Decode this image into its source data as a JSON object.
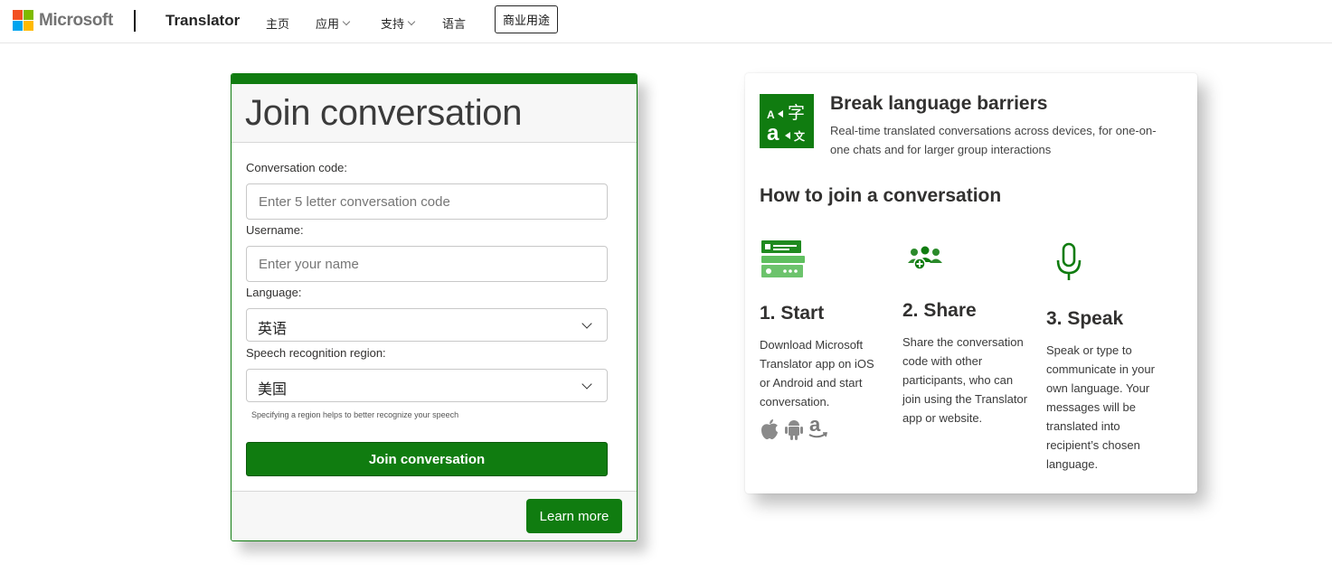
{
  "nav": {
    "logo_text": "Microsoft",
    "logo_colors": [
      "#f25022",
      "#7fba00",
      "#00a4ef",
      "#ffb900"
    ],
    "brand": "Translator",
    "links": [
      {
        "label": "主页",
        "has_menu": false
      },
      {
        "label": "应用",
        "has_menu": true
      },
      {
        "label": "支持",
        "has_menu": true
      },
      {
        "label": "语言",
        "has_menu": false
      }
    ],
    "business_button": "商业用途"
  },
  "join": {
    "title": "Join conversation",
    "code_label": "Conversation code:",
    "code_placeholder": "Enter 5 letter conversation code",
    "username_label": "Username:",
    "username_placeholder": "Enter your name",
    "language_label": "Language:",
    "language_value": "英语",
    "region_label": "Speech recognition region:",
    "region_value": "美国",
    "region_hint": "Specifying a region helps to better recognize your speech",
    "join_button": "Join conversation",
    "learn_more": "Learn more"
  },
  "info": {
    "title": "Break language barriers",
    "subtitle": "Real-time translated conversations across devices, for one-on-one chats and for larger group interactions",
    "howto": "How to join a conversation",
    "steps": [
      {
        "title": "1. Start",
        "text": "Download Microsoft Translator app on iOS or Android and start conversation.",
        "icon": "start-screen-icon"
      },
      {
        "title": "2. Share",
        "text": "Share the conversation code with other participants, who can join using the Translator app or website.",
        "icon": "people-share-icon"
      },
      {
        "title": "3. Speak",
        "text": "Speak or type to communicate in your own language. Your messages will be translated into recipient’s chosen language.",
        "icon": "microphone-icon"
      }
    ],
    "platform_icons": [
      "apple-icon",
      "android-icon",
      "amazon-icon"
    ]
  },
  "colors": {
    "accent": "#107c10"
  }
}
